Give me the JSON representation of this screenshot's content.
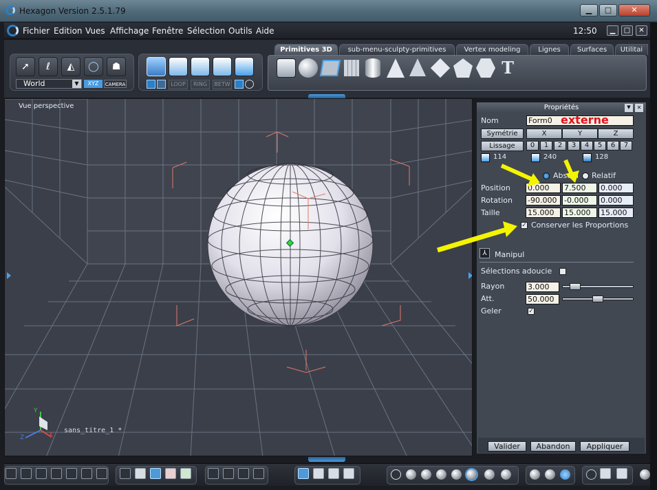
{
  "window": {
    "title": "Hexagon Version 2.5.1.79",
    "controls": {
      "minimize": "▁",
      "maximize": "□",
      "close": "✕"
    }
  },
  "menubar": {
    "items": [
      "Fichier",
      "Edition",
      "Vues",
      "Affichage",
      "Fenêtre",
      "Sélection",
      "Outils",
      "Aide"
    ],
    "clock": "12:50",
    "controls": {
      "minimize": "▁",
      "maximize": "□",
      "close": "✕"
    }
  },
  "toolbar": {
    "world_select": "World",
    "xyz_label": "XYZ",
    "camera_label": "CAMERA",
    "sel_modes": [
      "LOOP",
      "RING",
      "BETW"
    ],
    "tabs": [
      "Primitives 3D",
      "sub-menu-sculpty-primitives",
      "Vertex modeling",
      "Lignes",
      "Surfaces",
      "Utilitai"
    ],
    "active_tab": "Primitives 3D",
    "manip_icons": [
      "arrow-select-icon",
      "lasso-icon",
      "magic-select-icon",
      "sphere-select-icon",
      "ghost-icon"
    ],
    "selection_icons": [
      "cube-point-icon",
      "cube-edge-icon",
      "cube-face-icon",
      "cube-object-icon",
      "cube-all-icon"
    ],
    "primitive_icons": [
      "cube-icon",
      "sphere-icon",
      "plane-icon",
      "grid-icon",
      "cylinder-icon",
      "cone-icon",
      "pyramid-icon",
      "diamond-icon",
      "dodecahedron-icon",
      "geosphere-icon",
      "text-3d-icon"
    ]
  },
  "viewport": {
    "label": "Vue perspective",
    "filename": "sans_titre_1 *",
    "axis": {
      "y": "Y",
      "x": "X",
      "z": "Z"
    },
    "bg_color": "#3b3f4a",
    "grid_color": "#6f7a8c"
  },
  "annotation": {
    "text": "externe",
    "color": "#e0141c",
    "arrow_color": "#f4f400"
  },
  "properties": {
    "title": "Propriétés",
    "name_label": "Nom",
    "name_value": "Form0",
    "symmetry_btn": "Symétrie",
    "axes": [
      "X",
      "Y",
      "Z"
    ],
    "smooth_btn": "Lissage",
    "smooth_levels": [
      "0",
      "1",
      "2",
      "3",
      "4",
      "5",
      "6",
      "7"
    ],
    "counts": {
      "vertices": "114",
      "edges": "240",
      "faces": "128"
    },
    "mode_absolu": "Absolu",
    "mode_relatif": "Relatif",
    "position_label": "Position",
    "position": [
      "0.000",
      "7.500",
      "0.000"
    ],
    "rotation_label": "Rotation",
    "rotation": [
      "-90.000",
      "-0.000",
      "0.000"
    ],
    "taille_label": "Taille",
    "taille": [
      "15.000",
      "15.000",
      "15.000"
    ],
    "keep_proportions": "Conserver les Proportions",
    "keep_proportions_checked": true,
    "manipul_label": "Manipul",
    "soft_selection_label": "Sélections adoucie",
    "soft_selection_checked": false,
    "rayon_label": "Rayon",
    "rayon": "3.000",
    "rayon_level": 0.12,
    "att_label": "Att.",
    "att": "50.000",
    "att_level": 0.5,
    "geler_label": "Geler",
    "geler_checked": true,
    "valider": "Valider",
    "abandon": "Abandon",
    "appliquer": "Appliquer"
  },
  "bottombar": {
    "layout_icons": [
      "layout-1-icon",
      "layout-2-icon",
      "layout-3-icon",
      "layout-4-icon",
      "layout-5-icon",
      "layout-6-icon",
      "layout-7-icon"
    ],
    "display_icons": [
      "grid-display-icon",
      "brush-icon",
      "snap-grid-icon",
      "red-grid-icon",
      "green-grid-icon"
    ],
    "nav_icons": [
      "zoom-extents-icon",
      "pan-icon",
      "zoom-icon",
      "eye-icon"
    ],
    "gizmo_icons": [
      "move-gizmo-icon",
      "rotate-gizmo-icon",
      "scale-gizmo-icon",
      "drop-icon"
    ],
    "shading_icons": [
      "wireframe-sphere-icon",
      "shaded-wire-sphere-icon",
      "flat-sphere-icon",
      "smooth-wire-sphere-icon",
      "smooth-sphere-icon",
      "grey-sphere-icon",
      "white-sphere-icon"
    ],
    "render_icons": [
      "render-1-icon",
      "render-2-icon",
      "render-3-icon"
    ],
    "extra_icons": [
      "settings-icon",
      "boxes-icon",
      "materials-icon"
    ]
  }
}
